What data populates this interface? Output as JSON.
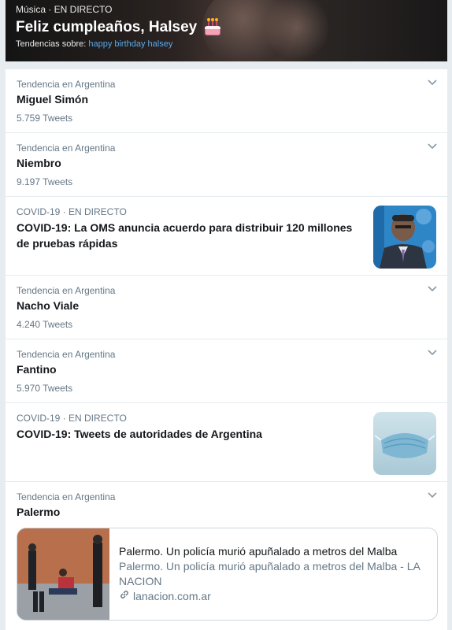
{
  "hero": {
    "context": "Música · EN DIRECTO",
    "title": "Feliz cumpleaños, Halsey",
    "trending_prefix": "Tendencias sobre:",
    "trending_link": "happy birthday halsey"
  },
  "trends": [
    {
      "context": "Tendencia en Argentina",
      "name": "Miguel Simón",
      "count": "5.759 Tweets"
    },
    {
      "context": "Tendencia en Argentina",
      "name": "Niembro",
      "count": "9.197 Tweets"
    }
  ],
  "news1": {
    "context": "COVID-19 · EN DIRECTO",
    "headline": "COVID-19: La OMS anuncia acuerdo para distribuir 120 millones de pruebas rápidas"
  },
  "trends2": [
    {
      "context": "Tendencia en Argentina",
      "name": "Nacho Viale",
      "count": "4.240 Tweets"
    },
    {
      "context": "Tendencia en Argentina",
      "name": "Fantino",
      "count": "5.970 Tweets"
    }
  ],
  "news2": {
    "context": "COVID-19 · EN DIRECTO",
    "headline": "COVID-19: Tweets de autoridades de Argentina"
  },
  "trend_last": {
    "context": "Tendencia en Argentina",
    "name": "Palermo",
    "card": {
      "title": "Palermo. Un policía murió apuñalado a metros del Malba",
      "description": "Palermo. Un policía murió apuñalado a metros del Malba - LA NACION",
      "domain": "lanacion.com.ar"
    }
  },
  "colors": {
    "accent_link": "#5aa9e8",
    "secondary_text": "#657786",
    "primary_text": "#14171a"
  }
}
